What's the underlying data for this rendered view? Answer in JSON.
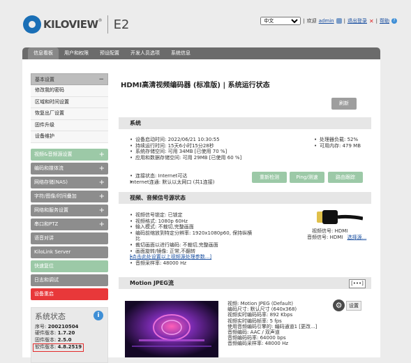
{
  "brand": {
    "logo_text": "KILOVIEW",
    "registered": "®",
    "model": "E2"
  },
  "topbar": {
    "language": "中文",
    "welcome": "欢迎",
    "user": "admin",
    "logout": "退出登录",
    "help": "帮助",
    "separator": "|"
  },
  "nav": {
    "tabs": [
      {
        "label": "信息看板"
      },
      {
        "label": "用户和权限"
      },
      {
        "label": "预设配置"
      },
      {
        "label": "开发人员选项"
      },
      {
        "label": "系统信息"
      }
    ]
  },
  "sidebar": {
    "basic": {
      "label": "基本设置",
      "toggle": "−",
      "items": [
        {
          "label": "修改我的密码"
        },
        {
          "label": "区域和时间设置"
        },
        {
          "label": "恢复出厂设置"
        },
        {
          "label": "固件升级"
        },
        {
          "label": "设备维护"
        }
      ]
    },
    "sections": [
      {
        "label": "视频&音频源设置",
        "toggle": "+"
      },
      {
        "label": "编码和媒体流",
        "toggle": "+"
      },
      {
        "label": "网络存储(NAS)",
        "toggle": "+"
      },
      {
        "label": "字符/图像/时间叠加",
        "toggle": "+"
      },
      {
        "label": "网络和服务设置",
        "toggle": "+"
      },
      {
        "label": "串口和PTZ",
        "toggle": "+"
      },
      {
        "label": "语音对讲",
        "toggle": ""
      },
      {
        "label": "KiloLink Server",
        "toggle": ""
      },
      {
        "label": "快速复位",
        "toggle": ""
      },
      {
        "label": "日志和调试",
        "toggle": ""
      },
      {
        "label": "设备重启",
        "toggle": ""
      }
    ],
    "status": {
      "title": "系统状态",
      "info_icon": "i",
      "lines": [
        {
          "label": "序号:",
          "value": "200210504"
        },
        {
          "label": "硬件版本:",
          "value": "1.7.20"
        },
        {
          "label": "固件版本:",
          "value": "2.5.0"
        },
        {
          "label": "软件版本:",
          "value": "4.8.2519"
        }
      ]
    }
  },
  "main": {
    "title": "HDMI高清视频编码器 (标准版) | 系统运行状态",
    "refresh": "刷新",
    "system": {
      "header": "系统",
      "left": [
        "设备启动时间: 2022/06/21 10:30:55",
        "持续运行时间: 15天6小时15分28秒",
        "系统存储空间: 可用 34MB [已使用 70 %]",
        "应用和数据存储空间: 可用 29MB [已使用 60 %]"
      ],
      "right": [
        "处理器负载: 52%",
        "可用内存: 479 MB"
      ],
      "net": [
        "连接状态: Internet可达",
        "Internet连通: 默认以太网口 (共1连接)"
      ],
      "buttons": {
        "recheck": "重新检测",
        "ping": "Ping/测速",
        "trace": "路由跟踪"
      }
    },
    "video": {
      "header": "视频、音频信号源状态",
      "items": [
        "视频信号锁定: 已锁定",
        "视频格式: 1080p 60Hz",
        "输入模式: 不裁切,完整画面",
        "编码前缩放到特定分辨率: 1920x1080p60, 保持纵横比",
        "裁切画面以进行编码: 不裁切,完整画面",
        "画面旋转/镜像: 正常,不翻转",
        "[点击此处设置以上视频源处理参数...]",
        "音频采样率: 48000 Hz"
      ],
      "video_signal": "视频信号: HDMI",
      "audio_signal": "音频信号: HDMI",
      "choose": "选择源..."
    },
    "mjpeg": {
      "header": "Motion JPEG流",
      "more": "[•••]",
      "settings": "设置",
      "lines": [
        "视频: Motion JPEG (Default)",
        "编码尺寸: 默认尺寸 (640x368)",
        "视频实时编码码率: 892 Kbps",
        "视频实时编码帧率: 5 fps",
        "使用音频编码引擎的: 编码通道1 [更改...]",
        "音频编码: AAC / 双声道",
        "音频编码码率: 64000 bps",
        "音频编码采样率: 48000 Hz"
      ]
    }
  },
  "colors": {
    "accent_blue": "#1a6fb6",
    "reboot_red": "#e8383a",
    "sidebar_green": "#9cc9a7",
    "sidebar_grey": "#8d8d8d",
    "highlight_red": "#e32b2b"
  }
}
